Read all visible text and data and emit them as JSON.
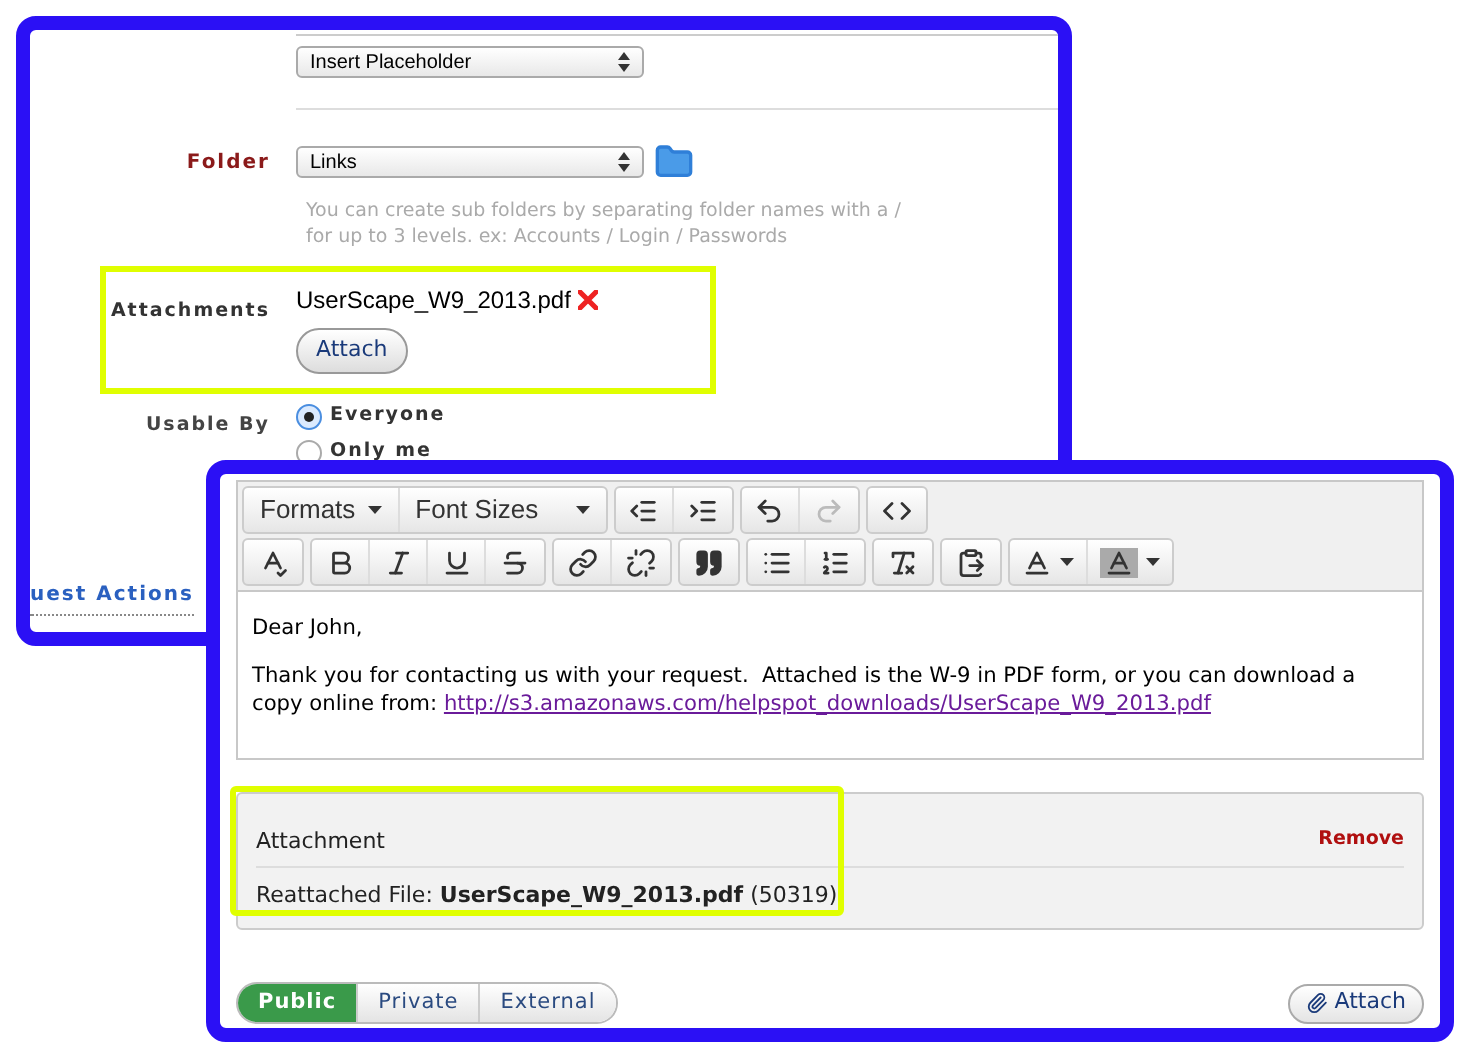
{
  "settings_panel": {
    "placeholder_select": {
      "value": "Insert Placeholder"
    },
    "folder": {
      "label": "Folder",
      "value": "Links",
      "hint_lines": [
        "You can create sub folders by separating folder names with a /",
        "for up to 3 levels. ex: Accounts / Login / Passwords"
      ]
    },
    "attachments": {
      "label": "Attachments",
      "file": "UserScape_W9_2013.pdf",
      "button": "Attach"
    },
    "usable_by": {
      "label": "Usable By",
      "options": [
        {
          "label": "Everyone",
          "selected": true
        },
        {
          "label": "Only me",
          "selected": false
        }
      ]
    },
    "section_link": "uest Actions"
  },
  "editor_panel": {
    "toolbar": {
      "menus": [
        {
          "label": "Formats"
        },
        {
          "label": "Font Sizes"
        }
      ],
      "history": [
        {
          "disabled": false
        },
        {
          "disabled": true
        }
      ]
    },
    "body": {
      "greeting": "Dear John,",
      "paragraph": "Thank you for contacting us with your request.  Attached is the W-9 in PDF form, or you can download a copy online from: ",
      "link": "http://s3.amazonaws.com/helpspot_downloads/UserScape_W9_2013.pdf"
    },
    "attachment": {
      "title": "Attachment",
      "remove": "Remove",
      "file_line": "Reattached File: **UserScape_W9_2013.pdf** (50319)"
    },
    "tabs": [
      {
        "label": "Public",
        "selected": true
      },
      {
        "label": "Private",
        "selected": false
      },
      {
        "label": "External",
        "selected": false
      }
    ],
    "attach_button": "Attach"
  }
}
